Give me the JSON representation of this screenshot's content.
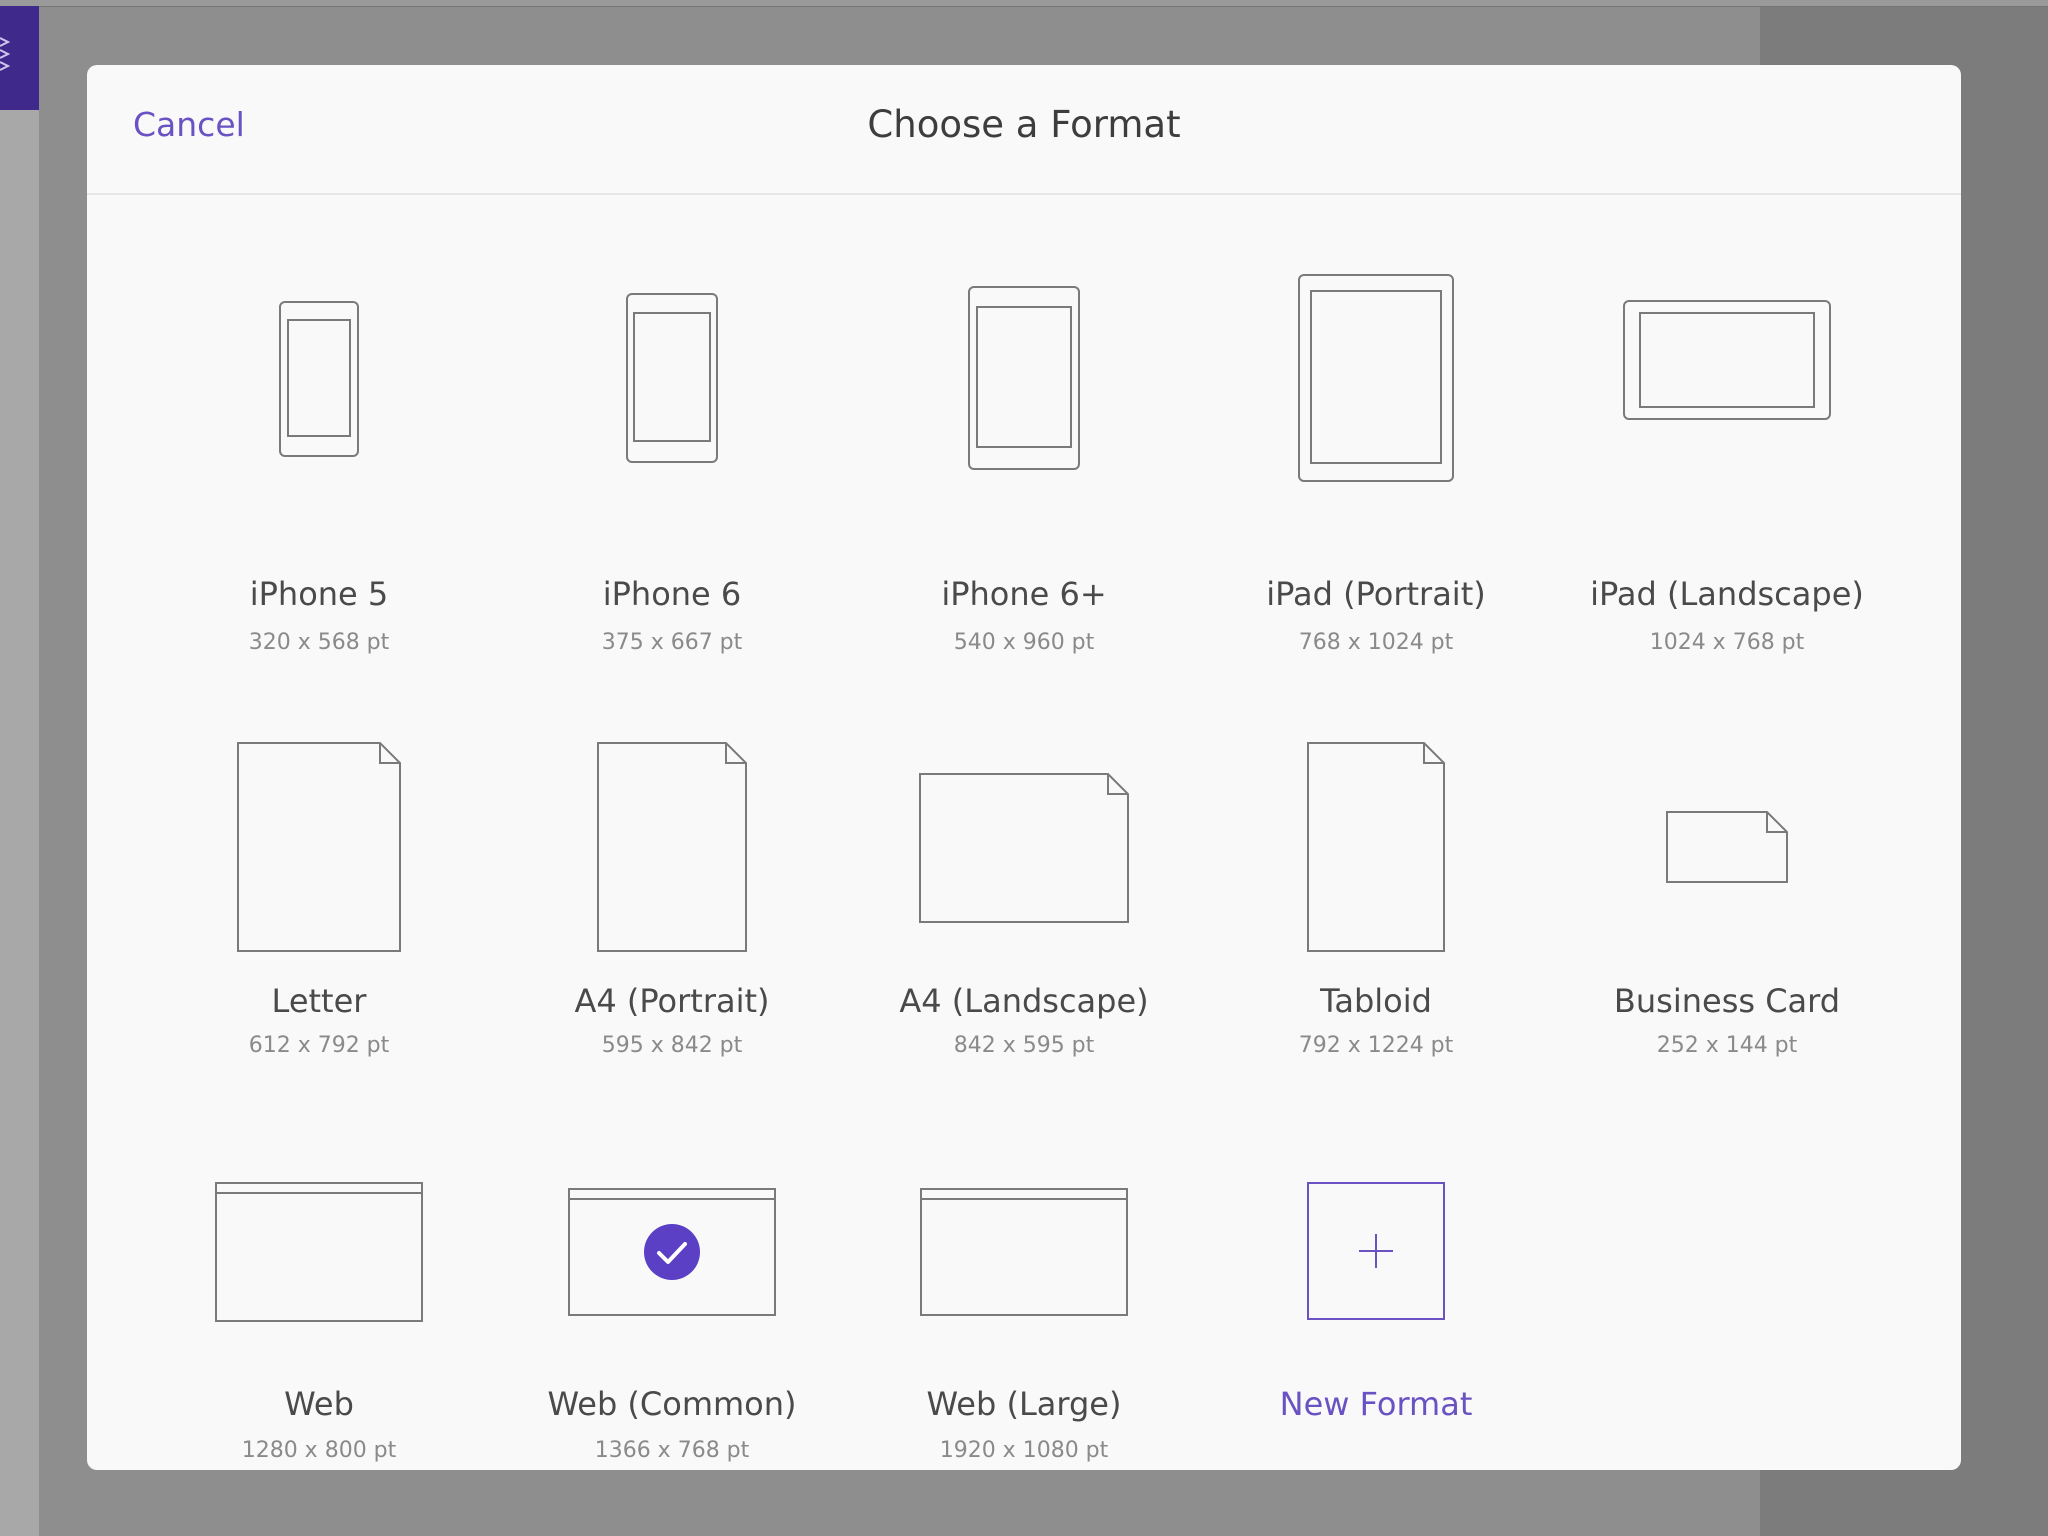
{
  "dialog": {
    "title": "Choose a Format",
    "cancel_label": "Cancel"
  },
  "formats": [
    {
      "name": "iPhone 5",
      "dims": "320 x 568 pt",
      "icon": "phone-icon"
    },
    {
      "name": "iPhone 6",
      "dims": "375 x 667 pt",
      "icon": "phone-icon"
    },
    {
      "name": "iPhone 6+",
      "dims": "540 x 960 pt",
      "icon": "phone-icon"
    },
    {
      "name": "iPad (Portrait)",
      "dims": "768 x 1024 pt",
      "icon": "tablet-portrait-icon"
    },
    {
      "name": "iPad (Landscape)",
      "dims": "1024 x 768 pt",
      "icon": "tablet-landscape-icon"
    },
    {
      "name": "Letter",
      "dims": "612 x 792 pt",
      "icon": "page-icon"
    },
    {
      "name": "A4 (Portrait)",
      "dims": "595 x 842 pt",
      "icon": "page-icon"
    },
    {
      "name": "A4 (Landscape)",
      "dims": "842 x 595 pt",
      "icon": "page-landscape-icon"
    },
    {
      "name": "Tabloid",
      "dims": "792 x 1224 pt",
      "icon": "page-icon"
    },
    {
      "name": "Business Card",
      "dims": "252 x 144 pt",
      "icon": "card-icon"
    },
    {
      "name": "Web",
      "dims": "1280 x 800 pt",
      "icon": "browser-window-icon"
    },
    {
      "name": "Web (Common)",
      "dims": "1366 x 768 pt",
      "icon": "browser-window-icon",
      "selected": true
    },
    {
      "name": "Web (Large)",
      "dims": "1920 x 1080 pt",
      "icon": "browser-window-icon"
    }
  ],
  "new_format": {
    "label": "New Format",
    "icon": "plus-icon"
  },
  "colors": {
    "accent": "#6a52c2",
    "selected_badge": "#5b3fc4",
    "icon_stroke": "#7a7a7a"
  }
}
